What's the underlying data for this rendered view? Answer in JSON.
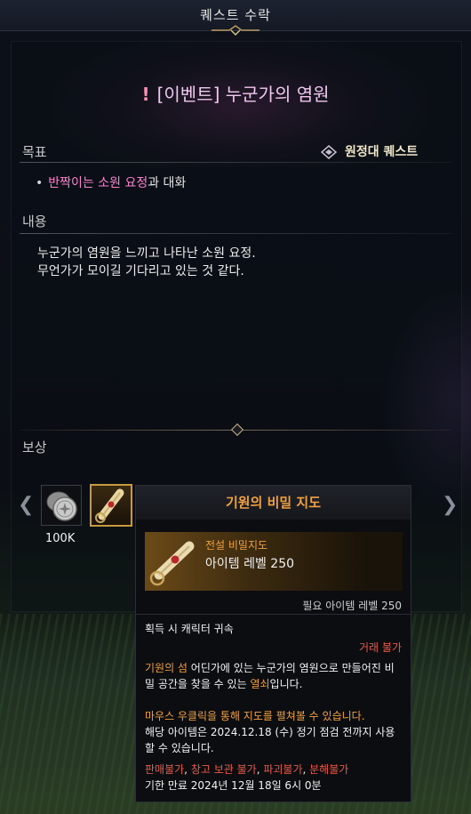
{
  "window": {
    "title": "퀘스트 수락"
  },
  "quest": {
    "title": "[이벤트] 누군가의 염원",
    "alert_icon": "exclamation-icon"
  },
  "objective": {
    "label": "목표",
    "type_label": "원정대 퀘스트",
    "type_icon": "expedition-emblem-icon",
    "items": [
      {
        "highlight": "반짝이는 소원 요정",
        "rest": "과 대화"
      }
    ]
  },
  "content": {
    "label": "내용",
    "lines": [
      "누군가의 염원을 느끼고 나타난 소원 요정.",
      "무언가가 모이길 기다리고 있는 것 같다."
    ]
  },
  "reward": {
    "label": "보상",
    "slots": [
      {
        "icon": "silver-coin-icon",
        "count": "100K"
      },
      {
        "icon": "treasure-map-icon",
        "count": ""
      }
    ]
  },
  "tooltip": {
    "name": "기원의 비밀 지도",
    "grade": "전설 비밀지도",
    "item_level": "아이템 레벨 250",
    "required_level": "필요 아이템 레벨 250",
    "bind": "획득 시 캐릭터 귀속",
    "trade": "거래 불가",
    "desc_line1_orange1": "기원의 섬",
    "desc_line1_white": " 어딘가에 있는 누군가의 염원으로 만들어진 비",
    "desc_line2_white": "밀 공간을 찾을 수 있는 ",
    "desc_line2_orange": "열쇠",
    "desc_line2_white2": "입니다.",
    "usage": "마우스 우클릭을 통해 지도를 펼쳐볼 수 있습니다.",
    "expiry_note_1": "해당 아이템은 2024.12.18 (수) 정기 점검 전까지 사용",
    "expiry_note_2": "할 수 있습니다.",
    "restrictions": [
      "판매불가",
      "창고 보관 불가",
      "파괴불가",
      "분해불가"
    ],
    "restriction_sep": ", ",
    "expires": "기한 만료 2024년 12월 18일 6시 0분"
  },
  "colors": {
    "legendary": "#f0a040",
    "restricted": "#e85a4a",
    "highlight": "#ff80d0",
    "title": "#f0c8f0"
  }
}
